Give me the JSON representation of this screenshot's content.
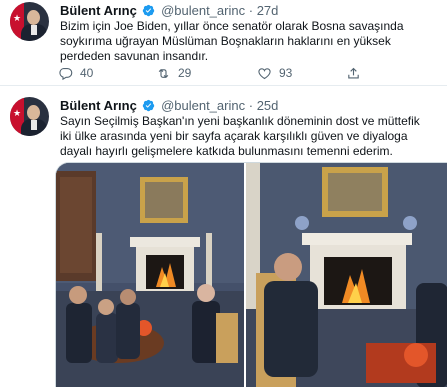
{
  "colors": {
    "accent": "#1d9bf0",
    "muted": "#536471",
    "text": "#0f1419",
    "divider": "#e6ecf0"
  },
  "tweets": [
    {
      "name": "Bülent Arınç",
      "handle": "@bulent_arinc",
      "separator": "·",
      "time": "27d",
      "verified": true,
      "text": "Bizim için Joe Biden, yıllar önce senatör olarak Bosna savaşında soykırıma uğrayan Müslüman Boşnakların haklarını en yüksek perdeden savunan insandır.",
      "replies": "40",
      "retweets": "29",
      "likes": "93",
      "icons": [
        "reply-icon",
        "retweet-icon",
        "like-icon",
        "share-icon"
      ]
    },
    {
      "name": "Bülent Arınç",
      "handle": "@bulent_arinc",
      "separator": "·",
      "time": "25d",
      "verified": true,
      "text": "Sayın Seçilmiş Başkan'ın yeni başkanlık döneminin dost ve müttefik iki ülke arasında yeni bir sayfa açarak karşılıklı güven ve diyaloga dayalı hayırlı gelişmelere katkıda bulunmasını temenni ederim.",
      "media": [
        "photo-meeting-fireplace-wide",
        "photo-meeting-fireplace-closeup"
      ]
    }
  ]
}
